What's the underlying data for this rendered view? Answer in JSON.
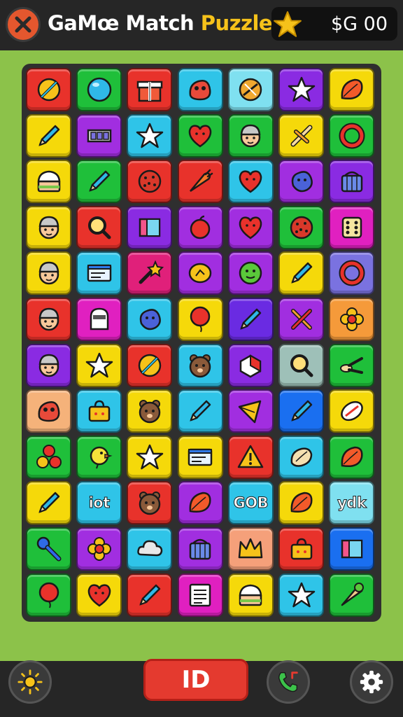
{
  "header": {
    "title_main": "GaMœ Match ",
    "title_accent": "Puzzle",
    "title_tm": "™",
    "coin_value": "$G 00",
    "close_icon": "close-icon",
    "coin_icon": "star-icon"
  },
  "footer": {
    "play_label": "ID",
    "left_icon": "sun-icon",
    "call_icon": "phone-icon",
    "settings_icon": "gear-icon"
  },
  "colors": {
    "background": "#8cc24a",
    "header": "#262626",
    "board": "#2f2f2f",
    "accent": "#f6c21a",
    "play_button": "#e43a2f"
  },
  "board": {
    "columns": 7,
    "rows": 12,
    "tiles": [
      {
        "bg": "#e8322b",
        "icon": "pencil-ball"
      },
      {
        "bg": "#1fbf3a",
        "icon": "ball"
      },
      {
        "bg": "#e8322b",
        "icon": "gift"
      },
      {
        "bg": "#2fc4e8",
        "icon": "creature"
      },
      {
        "bg": "#7fe0f0",
        "icon": "bread"
      },
      {
        "bg": "#8a2be2",
        "icon": "star"
      },
      {
        "bg": "#f5d90a",
        "icon": "leaf"
      },
      {
        "bg": "#f5d90a",
        "icon": "pencil"
      },
      {
        "bg": "#a12ee0",
        "icon": "cards"
      },
      {
        "bg": "#2fc4e8",
        "icon": "star"
      },
      {
        "bg": "#1fbf3a",
        "icon": "heart"
      },
      {
        "bg": "#1fbf3a",
        "icon": "face"
      },
      {
        "bg": "#f5d90a",
        "icon": "sticks"
      },
      {
        "bg": "#1fbf3a",
        "icon": "ring"
      },
      {
        "bg": "#f5d90a",
        "icon": "cake"
      },
      {
        "bg": "#1fbf3a",
        "icon": "pencil"
      },
      {
        "bg": "#e8322b",
        "icon": "cookie"
      },
      {
        "bg": "#e8322b",
        "icon": "carrot"
      },
      {
        "bg": "#2fc4e8",
        "icon": "heart"
      },
      {
        "bg": "#a12ee0",
        "icon": "blob"
      },
      {
        "bg": "#8a2be2",
        "icon": "basket"
      },
      {
        "bg": "#f5d90a",
        "icon": "face"
      },
      {
        "bg": "#e8322b",
        "icon": "magnifier"
      },
      {
        "bg": "#8a2be2",
        "icon": "book"
      },
      {
        "bg": "#a12ee0",
        "icon": "apple"
      },
      {
        "bg": "#a12ee0",
        "icon": "heart"
      },
      {
        "bg": "#1fbf3a",
        "icon": "cookie"
      },
      {
        "bg": "#e020c0",
        "icon": "dice"
      },
      {
        "bg": "#f5d90a",
        "icon": "face"
      },
      {
        "bg": "#2fc4e8",
        "icon": "panel"
      },
      {
        "bg": "#e0207a",
        "icon": "wand"
      },
      {
        "bg": "#a12ee0",
        "icon": "lemon"
      },
      {
        "bg": "#a12ee0",
        "icon": "lime"
      },
      {
        "bg": "#f5d90a",
        "icon": "pencil"
      },
      {
        "bg": "#7a72e0",
        "icon": "ring"
      },
      {
        "bg": "#e8322b",
        "icon": "face"
      },
      {
        "bg": "#e020c0",
        "icon": "ghost"
      },
      {
        "bg": "#2fc4e8",
        "icon": "blob"
      },
      {
        "bg": "#f5d90a",
        "icon": "balloon"
      },
      {
        "bg": "#6a2be2",
        "icon": "pencil"
      },
      {
        "bg": "#a12ee0",
        "icon": "tools"
      },
      {
        "bg": "#f59a3a",
        "icon": "flower"
      },
      {
        "bg": "#8a2be2",
        "icon": "face"
      },
      {
        "bg": "#f5d90a",
        "icon": "star"
      },
      {
        "bg": "#e8322b",
        "icon": "pencil-ball"
      },
      {
        "bg": "#2fc4e8",
        "icon": "bear"
      },
      {
        "bg": "#8a2be2",
        "icon": "cube"
      },
      {
        "bg": "#9ec0b8",
        "icon": "magnifier"
      },
      {
        "bg": "#1fbf3a",
        "icon": "scissors"
      },
      {
        "bg": "#f5b27a",
        "icon": "creature"
      },
      {
        "bg": "#2fc4e8",
        "icon": "bag"
      },
      {
        "bg": "#f5d90a",
        "icon": "bear"
      },
      {
        "bg": "#2fc4e8",
        "icon": "pencil"
      },
      {
        "bg": "#a12ee0",
        "icon": "kite"
      },
      {
        "bg": "#1a6ff0",
        "icon": "pencil"
      },
      {
        "bg": "#f5d90a",
        "icon": "rugby"
      },
      {
        "bg": "#1fbf3a",
        "icon": "dots"
      },
      {
        "bg": "#1fbf3a",
        "icon": "chick"
      },
      {
        "bg": "#f5d90a",
        "icon": "star"
      },
      {
        "bg": "#f5d90a",
        "icon": "panel"
      },
      {
        "bg": "#e8322b",
        "icon": "warning"
      },
      {
        "bg": "#2fc4e8",
        "icon": "nut"
      },
      {
        "bg": "#1fbf3a",
        "icon": "leaf"
      },
      {
        "bg": "#f5d90a",
        "icon": "pencil"
      },
      {
        "bg": "#2fc4e8",
        "icon": "text",
        "text": "iot"
      },
      {
        "bg": "#e8322b",
        "icon": "bear"
      },
      {
        "bg": "#a12ee0",
        "icon": "leaf"
      },
      {
        "bg": "#2fc4e8",
        "icon": "text",
        "text": "GOB"
      },
      {
        "bg": "#f5d90a",
        "icon": "leaf"
      },
      {
        "bg": "#7fe0f0",
        "icon": "text",
        "text": "ydk"
      },
      {
        "bg": "#1fbf3a",
        "icon": "key"
      },
      {
        "bg": "#a12ee0",
        "icon": "flower"
      },
      {
        "bg": "#2fc4e8",
        "icon": "cloud"
      },
      {
        "bg": "#a12ee0",
        "icon": "basket"
      },
      {
        "bg": "#f5a07a",
        "icon": "crown"
      },
      {
        "bg": "#e8322b",
        "icon": "bag"
      },
      {
        "bg": "#1a6ff0",
        "icon": "book"
      },
      {
        "bg": "#1fbf3a",
        "icon": "balloon"
      },
      {
        "bg": "#f5d90a",
        "icon": "heart"
      },
      {
        "bg": "#e8322b",
        "icon": "pencil"
      },
      {
        "bg": "#e020c0",
        "icon": "list"
      },
      {
        "bg": "#f5d90a",
        "icon": "cake"
      },
      {
        "bg": "#2fc4e8",
        "icon": "star"
      },
      {
        "bg": "#1fbf3a",
        "icon": "cone"
      }
    ]
  }
}
